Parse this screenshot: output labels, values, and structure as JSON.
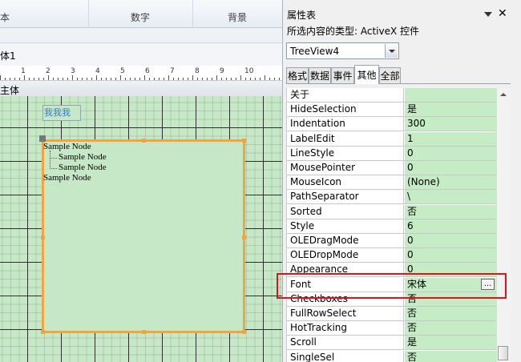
{
  "ribbon": {
    "group1_label": "本",
    "group2_label": "数字",
    "group3_label": "背景"
  },
  "document": {
    "tab_label": "体1",
    "section_label": "主体"
  },
  "ruler": {
    "numbers": [
      "1",
      "2",
      "3",
      "4",
      "5",
      "6",
      "7",
      "8",
      "9",
      "10"
    ]
  },
  "form": {
    "label_text": "我我我",
    "tree_nodes": [
      "Sample Node",
      "Sample Node",
      "Sample Node",
      "Sample Node"
    ]
  },
  "property_sheet": {
    "title": "属性表",
    "selection_type": "所选内容的类型: ActiveX 控件",
    "object_name": "TreeView4",
    "tabs": [
      "格式",
      "数据",
      "事件",
      "其他",
      "全部"
    ],
    "active_tab": "其他",
    "rows": [
      {
        "name": "关于",
        "value": ""
      },
      {
        "name": "HideSelection",
        "value": "是"
      },
      {
        "name": "Indentation",
        "value": "300"
      },
      {
        "name": "LabelEdit",
        "value": "1"
      },
      {
        "name": "LineStyle",
        "value": "0"
      },
      {
        "name": "MousePointer",
        "value": "0"
      },
      {
        "name": "MouseIcon",
        "value": "(None)"
      },
      {
        "name": "PathSeparator",
        "value": "\\"
      },
      {
        "name": "Sorted",
        "value": "否"
      },
      {
        "name": "Style",
        "value": "6"
      },
      {
        "name": "OLEDragMode",
        "value": "0"
      },
      {
        "name": "OLEDropMode",
        "value": "0"
      },
      {
        "name": "Appearance",
        "value": "0"
      },
      {
        "name": "Font",
        "value": "宋体"
      },
      {
        "name": "Checkboxes",
        "value": "否"
      },
      {
        "name": "FullRowSelect",
        "value": "否"
      },
      {
        "name": "HotTracking",
        "value": "否"
      },
      {
        "name": "Scroll",
        "value": "是"
      },
      {
        "name": "SingleSel",
        "value": "否"
      }
    ],
    "ellipsis_label": "...",
    "close_label": "✕"
  },
  "colors": {
    "highlight": "#d9161e",
    "selection_border": "#f0a540",
    "grid_background": "#c6e8c6"
  }
}
